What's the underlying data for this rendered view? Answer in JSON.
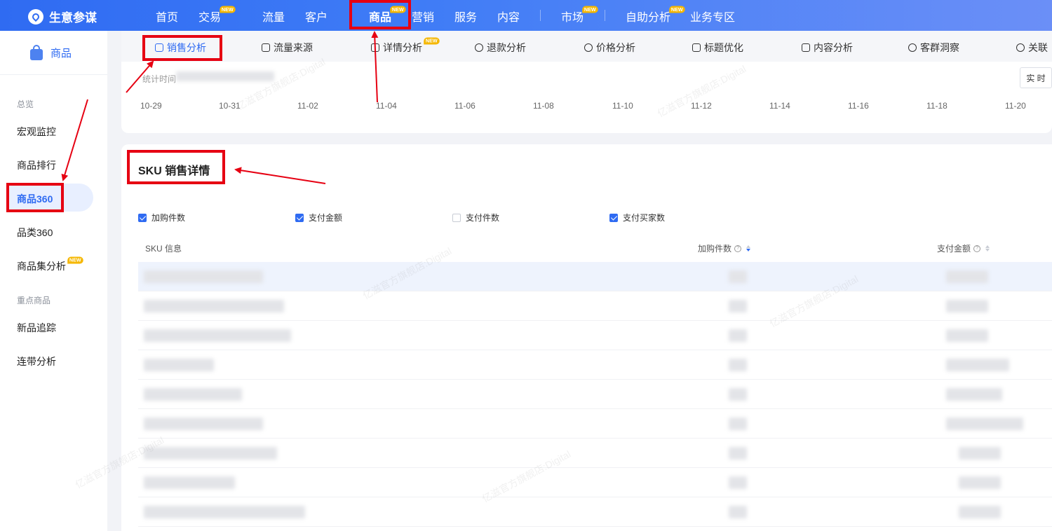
{
  "header": {
    "app_name": "生意参谋",
    "nav": [
      {
        "label": "首页",
        "new": false
      },
      {
        "label": "交易",
        "new": true
      },
      {
        "label": "流量",
        "new": false
      },
      {
        "label": "客户",
        "new": false
      },
      {
        "label": "商品",
        "new": true,
        "active": true
      },
      {
        "label": "营销",
        "new": false
      },
      {
        "label": "服务",
        "new": false
      },
      {
        "label": "内容",
        "new": false
      },
      {
        "label": "市场",
        "new": true
      },
      {
        "label": "自助分析",
        "new": true
      },
      {
        "label": "业务专区",
        "new": false
      }
    ],
    "new_badge": "NEW"
  },
  "sidebar": {
    "section_title": "商品",
    "group_overview": "总览",
    "items_overview": [
      "宏观监控",
      "商品排行",
      "商品360",
      "品类360",
      "商品集分析"
    ],
    "active_item": "商品360",
    "group_key": "重点商品",
    "items_key": [
      "新品追踪",
      "连带分析"
    ],
    "new_badge": "NEW"
  },
  "tabs": [
    {
      "label": "销售分析",
      "active": true,
      "icon": "bag-icon"
    },
    {
      "label": "流量来源",
      "icon": "chart-icon"
    },
    {
      "label": "详情分析",
      "icon": "detail-icon",
      "new": true
    },
    {
      "label": "退款分析",
      "icon": "refund-icon"
    },
    {
      "label": "价格分析",
      "icon": "price-icon"
    },
    {
      "label": "标题优化",
      "icon": "title-icon"
    },
    {
      "label": "内容分析",
      "icon": "content-icon"
    },
    {
      "label": "客群洞察",
      "icon": "users-icon"
    },
    {
      "label": "关联",
      "icon": "link-icon"
    }
  ],
  "timeline": {
    "stat_label": "统计时间",
    "realtime_button": "实 时",
    "dates": [
      "10-29",
      "10-31",
      "11-02",
      "11-04",
      "11-06",
      "11-08",
      "11-10",
      "11-12",
      "11-14",
      "11-16",
      "11-18",
      "11-20"
    ]
  },
  "sku": {
    "title": "SKU 销售详情",
    "checkboxes": [
      {
        "label": "加购件数",
        "checked": true
      },
      {
        "label": "支付金额",
        "checked": true
      },
      {
        "label": "支付件数",
        "checked": false
      },
      {
        "label": "支付买家数",
        "checked": true
      }
    ],
    "columns": [
      "SKU 信息",
      "加购件数",
      "支付金额"
    ],
    "row_count": 9
  },
  "watermark_text": "亿滋官方旗舰店:Digital",
  "colors": {
    "accent": "#2f6bf2",
    "annotation": "#e60012",
    "badge": "#f5b700"
  }
}
